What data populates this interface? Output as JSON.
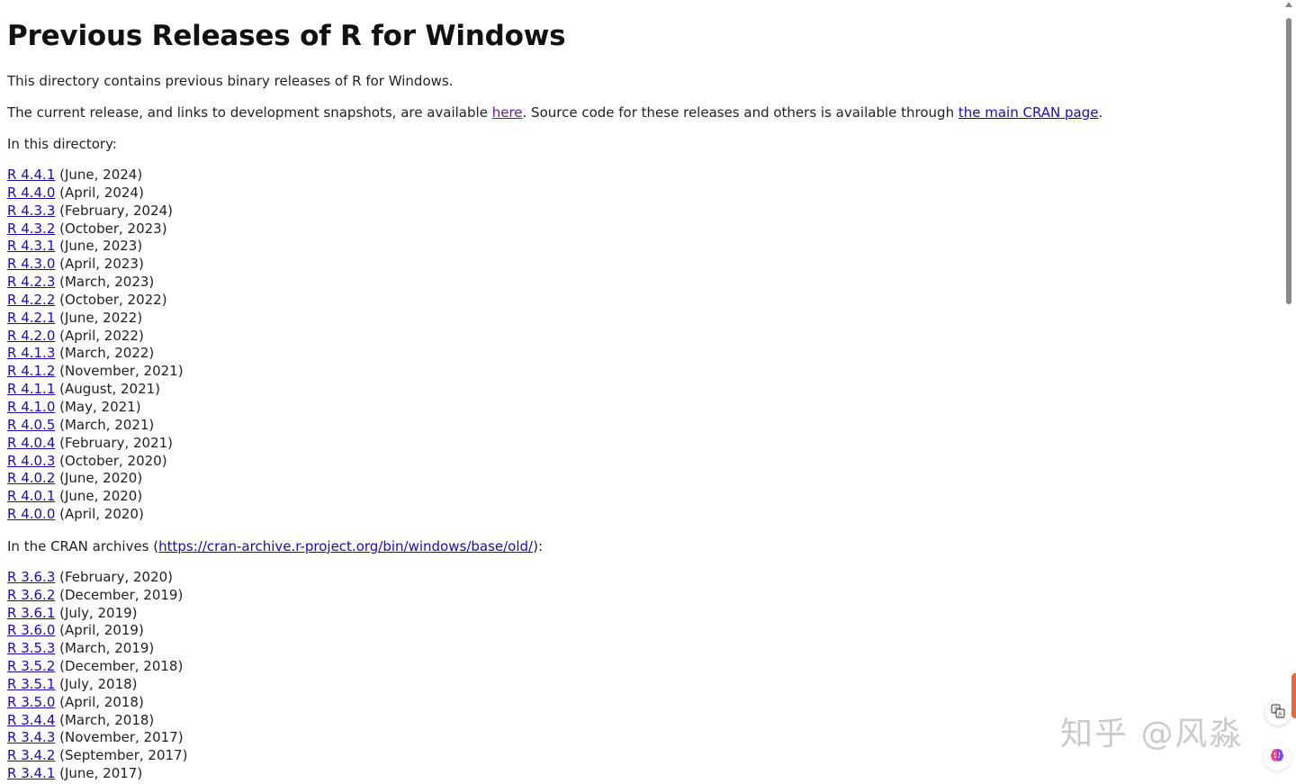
{
  "heading": "Previous Releases of R for Windows",
  "intro": "This directory contains previous binary releases of R for Windows.",
  "current": {
    "text_before": "The current release, and links to development snapshots, are available ",
    "here_link": "here",
    "text_middle": ". Source code for these releases and others is available through ",
    "cran_link": "the main CRAN page",
    "text_after": "."
  },
  "in_directory_label": "In this directory:",
  "releases": [
    {
      "version": "R 4.4.1",
      "date": " (June, 2024)"
    },
    {
      "version": "R 4.4.0",
      "date": " (April, 2024)"
    },
    {
      "version": "R 4.3.3",
      "date": " (February, 2024)"
    },
    {
      "version": "R 4.3.2",
      "date": " (October, 2023)"
    },
    {
      "version": "R 4.3.1",
      "date": " (June, 2023)"
    },
    {
      "version": "R 4.3.0",
      "date": " (April, 2023)"
    },
    {
      "version": "R 4.2.3",
      "date": " (March, 2023)"
    },
    {
      "version": "R 4.2.2",
      "date": " (October, 2022)"
    },
    {
      "version": "R 4.2.1",
      "date": " (June, 2022)"
    },
    {
      "version": "R 4.2.0",
      "date": " (April, 2022)"
    },
    {
      "version": "R 4.1.3",
      "date": " (March, 2022)"
    },
    {
      "version": "R 4.1.2",
      "date": " (November, 2021)"
    },
    {
      "version": "R 4.1.1",
      "date": " (August, 2021)"
    },
    {
      "version": "R 4.1.0",
      "date": " (May, 2021)"
    },
    {
      "version": "R 4.0.5",
      "date": " (March, 2021)"
    },
    {
      "version": "R 4.0.4",
      "date": " (February, 2021)"
    },
    {
      "version": "R 4.0.3",
      "date": " (October, 2020)"
    },
    {
      "version": "R 4.0.2",
      "date": " (June, 2020)"
    },
    {
      "version": "R 4.0.1",
      "date": " (June, 2020)"
    },
    {
      "version": "R 4.0.0",
      "date": " (April, 2020)"
    }
  ],
  "archives": {
    "text_before": "In the CRAN archives (",
    "link": "https://cran-archive.r-project.org/bin/windows/base/old/",
    "text_after": "):"
  },
  "archive_releases": [
    {
      "version": "R 3.6.3",
      "date": " (February, 2020)"
    },
    {
      "version": "R 3.6.2",
      "date": " (December, 2019)"
    },
    {
      "version": "R 3.6.1",
      "date": " (July, 2019)"
    },
    {
      "version": "R 3.6.0",
      "date": " (April, 2019)"
    },
    {
      "version": "R 3.5.3",
      "date": " (March, 2019)"
    },
    {
      "version": "R 3.5.2",
      "date": " (December, 2018)"
    },
    {
      "version": "R 3.5.1",
      "date": " (July, 2018)"
    },
    {
      "version": "R 3.5.0",
      "date": " (April, 2018)"
    },
    {
      "version": "R 3.4.4",
      "date": " (March, 2018)"
    },
    {
      "version": "R 3.4.3",
      "date": " (November, 2017)"
    },
    {
      "version": "R 3.4.2",
      "date": " (September, 2017)"
    },
    {
      "version": "R 3.4.1",
      "date": " (June, 2017)"
    }
  ],
  "watermark": "知乎 @风淼",
  "colors": {
    "link": "#1a0dab",
    "visited_link": "#681da8",
    "text": "#222222",
    "side_tab": "#e8693a"
  },
  "icons": {
    "translate": "translate-icon",
    "brain": "brain-icon"
  }
}
